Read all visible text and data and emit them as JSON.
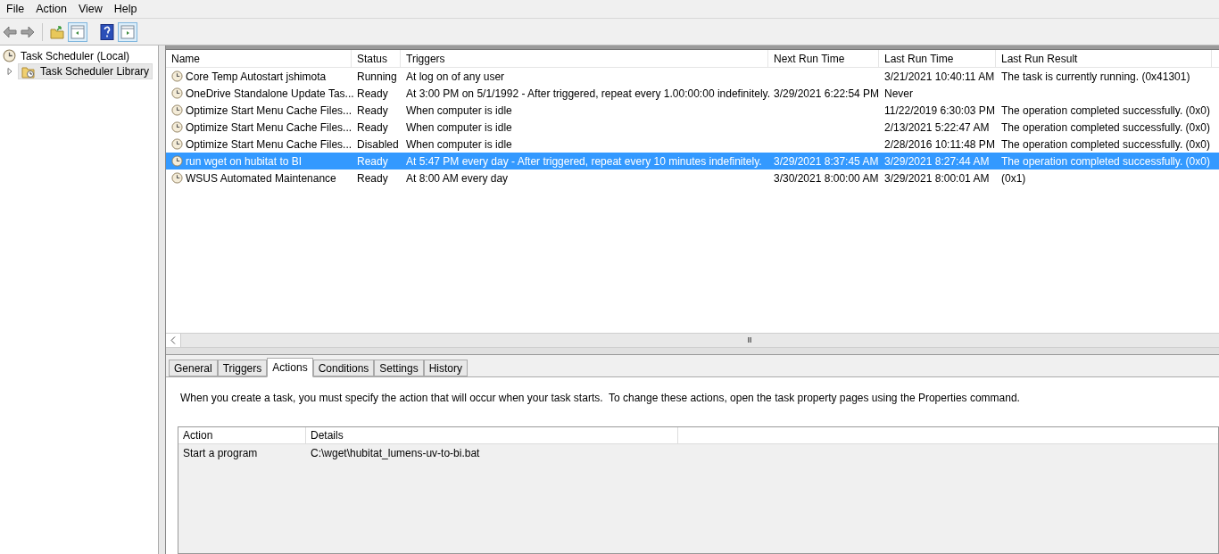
{
  "menu": [
    "File",
    "Action",
    "View",
    "Help"
  ],
  "tree": {
    "root": "Task Scheduler (Local)",
    "children": [
      {
        "label": "Task Scheduler Library",
        "selected": true,
        "expanded": false
      }
    ]
  },
  "tasks": {
    "columns": [
      "Name",
      "Status",
      "Triggers",
      "Next Run Time",
      "Last Run Time",
      "Last Run Result"
    ],
    "rows": [
      {
        "selected": false,
        "cells": [
          "Core Temp Autostart jshimota",
          "Running",
          "At log on of any user",
          "",
          "3/21/2021 10:40:11 AM",
          "The task is currently running. (0x41301)"
        ]
      },
      {
        "selected": false,
        "cells": [
          "OneDrive Standalone Update Tas...",
          "Ready",
          "At 3:00 PM on 5/1/1992 - After triggered, repeat every 1.00:00:00 indefinitely.",
          "3/29/2021 6:22:54 PM",
          "Never",
          ""
        ]
      },
      {
        "selected": false,
        "cells": [
          "Optimize Start Menu Cache Files...",
          "Ready",
          "When computer is idle",
          "",
          "11/22/2019 6:30:03 PM",
          "The operation completed successfully. (0x0)"
        ]
      },
      {
        "selected": false,
        "cells": [
          "Optimize Start Menu Cache Files...",
          "Ready",
          "When computer is idle",
          "",
          "2/13/2021 5:22:47 AM",
          "The operation completed successfully. (0x0)"
        ]
      },
      {
        "selected": false,
        "cells": [
          "Optimize Start Menu Cache Files...",
          "Disabled",
          "When computer is idle",
          "",
          "2/28/2016 10:11:48 PM",
          "The operation completed successfully. (0x0)"
        ]
      },
      {
        "selected": true,
        "cells": [
          "run wget on hubitat to BI",
          "Ready",
          "At 5:47 PM every day - After triggered, repeat every 10 minutes indefinitely.",
          "3/29/2021 8:37:45 AM",
          "3/29/2021 8:27:44 AM",
          "The operation completed successfully. (0x0)"
        ]
      },
      {
        "selected": false,
        "cells": [
          "WSUS Automated Maintenance",
          "Ready",
          "At 8:00 AM every day",
          "3/30/2021 8:00:00 AM",
          "3/29/2021 8:00:01 AM",
          "(0x1)"
        ]
      }
    ]
  },
  "scrollbar_grip": "III",
  "tabs": [
    {
      "label": "General",
      "selected": false
    },
    {
      "label": "Triggers",
      "selected": false
    },
    {
      "label": "Actions",
      "selected": true
    },
    {
      "label": "Conditions",
      "selected": false
    },
    {
      "label": "Settings",
      "selected": false
    },
    {
      "label": "History",
      "selected": false
    }
  ],
  "actions_description": "When you create a task, you must specify the action that will occur when your task starts.  To change these actions, open the task property pages using the Properties command.",
  "actions": {
    "columns": [
      "Action",
      "Details"
    ],
    "rows": [
      {
        "cells": [
          "Start a program",
          "C:\\wget\\hubitat_lumens-uv-to-bi.bat"
        ]
      }
    ]
  }
}
